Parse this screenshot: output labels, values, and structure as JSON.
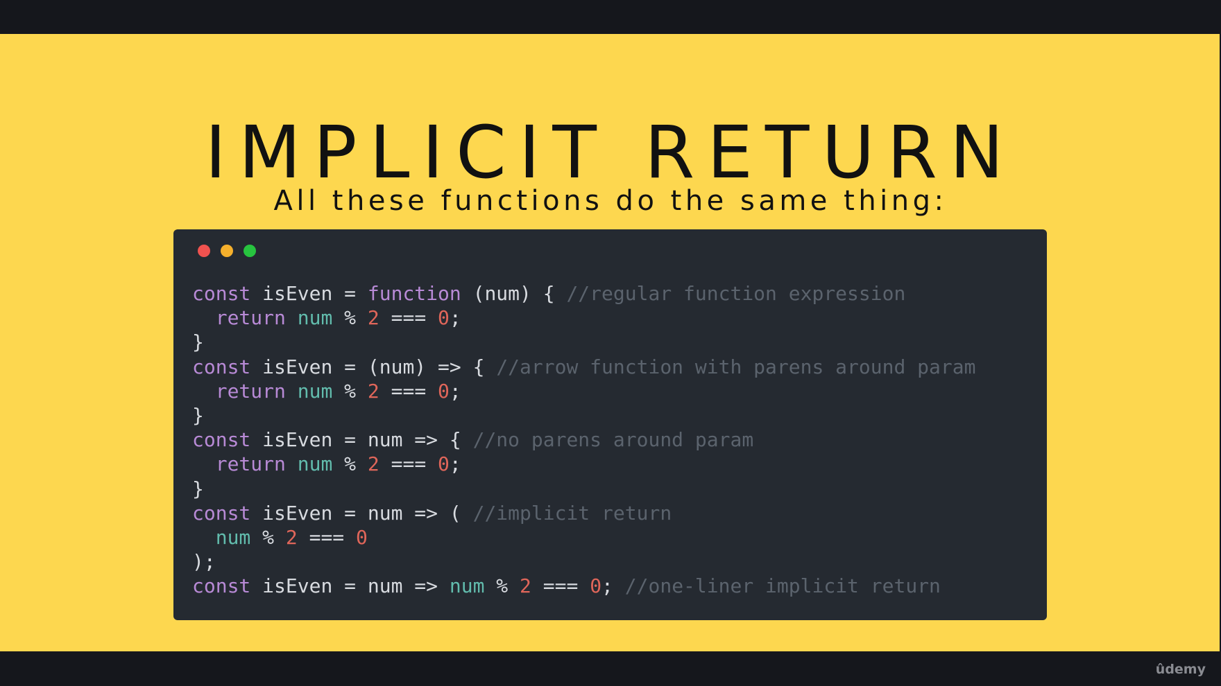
{
  "slide": {
    "title": "IMPLICIT RETURN",
    "subtitle": "All these functions do the same thing:"
  },
  "window_dots": {
    "red": "#f0524f",
    "yellow": "#f5b02c",
    "green": "#27c43f"
  },
  "colors": {
    "background": "#fdd74f",
    "code_background": "#252a31",
    "keyword": "#b88ad6",
    "variable": "#62bcad",
    "number": "#e0665a",
    "comment": "#5b636d"
  },
  "code_lines": [
    [
      [
        "keyword",
        "const"
      ],
      [
        "plain",
        " isEven = "
      ],
      [
        "keyword",
        "function"
      ],
      [
        "plain",
        " (num) { "
      ],
      [
        "comment",
        "//regular function expression"
      ]
    ],
    [
      [
        "plain",
        "  "
      ],
      [
        "keyword",
        "return"
      ],
      [
        "plain",
        " "
      ],
      [
        "var",
        "num"
      ],
      [
        "plain",
        " % "
      ],
      [
        "number",
        "2"
      ],
      [
        "plain",
        " === "
      ],
      [
        "number",
        "0"
      ],
      [
        "plain",
        ";"
      ]
    ],
    [
      [
        "plain",
        "}"
      ]
    ],
    [
      [
        "keyword",
        "const"
      ],
      [
        "plain",
        " isEven = (num) => { "
      ],
      [
        "comment",
        "//arrow function with parens around param"
      ]
    ],
    [
      [
        "plain",
        "  "
      ],
      [
        "keyword",
        "return"
      ],
      [
        "plain",
        " "
      ],
      [
        "var",
        "num"
      ],
      [
        "plain",
        " % "
      ],
      [
        "number",
        "2"
      ],
      [
        "plain",
        " === "
      ],
      [
        "number",
        "0"
      ],
      [
        "plain",
        ";"
      ]
    ],
    [
      [
        "plain",
        "}"
      ]
    ],
    [
      [
        "keyword",
        "const"
      ],
      [
        "plain",
        " isEven = num => { "
      ],
      [
        "comment",
        "//no parens around param"
      ]
    ],
    [
      [
        "plain",
        "  "
      ],
      [
        "keyword",
        "return"
      ],
      [
        "plain",
        " "
      ],
      [
        "var",
        "num"
      ],
      [
        "plain",
        " % "
      ],
      [
        "number",
        "2"
      ],
      [
        "plain",
        " === "
      ],
      [
        "number",
        "0"
      ],
      [
        "plain",
        ";"
      ]
    ],
    [
      [
        "plain",
        "}"
      ]
    ],
    [
      [
        "keyword",
        "const"
      ],
      [
        "plain",
        " isEven = num => ( "
      ],
      [
        "comment",
        "//implicit return"
      ]
    ],
    [
      [
        "plain",
        "  "
      ],
      [
        "var",
        "num"
      ],
      [
        "plain",
        " % "
      ],
      [
        "number",
        "2"
      ],
      [
        "plain",
        " === "
      ],
      [
        "number",
        "0"
      ]
    ],
    [
      [
        "plain",
        ");"
      ]
    ],
    [
      [
        "keyword",
        "const"
      ],
      [
        "plain",
        " isEven = num => "
      ],
      [
        "var",
        "num"
      ],
      [
        "plain",
        " % "
      ],
      [
        "number",
        "2"
      ],
      [
        "plain",
        " === "
      ],
      [
        "number",
        "0"
      ],
      [
        "plain",
        "; "
      ],
      [
        "comment",
        "//one-liner implicit return"
      ]
    ]
  ],
  "branding": {
    "logo": "ûdemy"
  }
}
